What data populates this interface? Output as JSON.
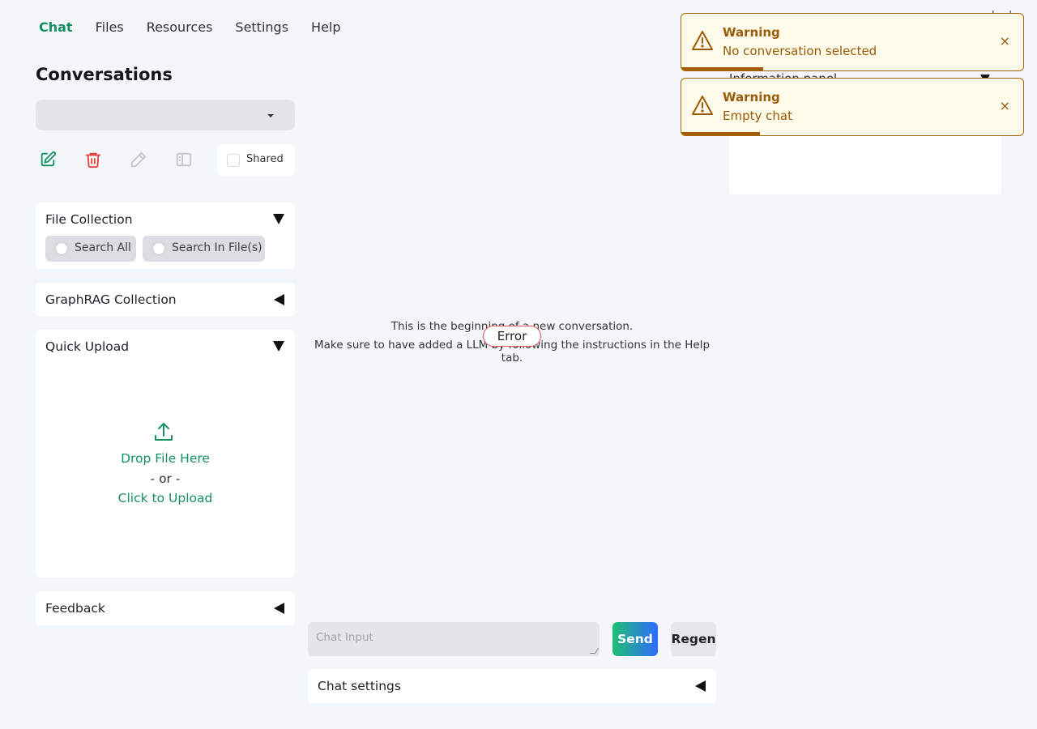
{
  "nav": {
    "items": [
      "Chat",
      "Files",
      "Resources",
      "Settings",
      "Help"
    ],
    "active_index": 0
  },
  "sidebar": {
    "conversations_title": "Conversations",
    "shared_label": "Shared",
    "file_collection": {
      "title": "File Collection",
      "options": [
        "Search All",
        "Search In File(s)"
      ]
    },
    "graphrag_title": "GraphRAG Collection",
    "quick_upload": {
      "title": "Quick Upload",
      "drop_text": "Drop File Here",
      "or_text": "- or -",
      "click_text": "Click to Upload"
    },
    "feedback_title": "Feedback"
  },
  "chat": {
    "welcome_line1": "This is the beginning of a new conversation.",
    "welcome_line2": "Make sure to have added a LLM by following the instructions in the Help tab.",
    "error_badge": "Error",
    "input_placeholder": "Chat Input",
    "send_label": "Send",
    "regen_label": "Regen",
    "settings_title": "Chat settings"
  },
  "right": {
    "peek_text": "Information panel",
    "corner_text": "ndual"
  },
  "toasts": [
    {
      "title": "Warning",
      "message": "No conversation selected",
      "close": "×",
      "progress": 0.24
    },
    {
      "title": "Warning",
      "message": "Empty chat",
      "close": "×",
      "progress": 0.23
    }
  ],
  "colors": {
    "accent": "#15915f",
    "danger": "#e53e3e",
    "warning": "#9a5b08",
    "warning_bg": "#fefbea"
  }
}
